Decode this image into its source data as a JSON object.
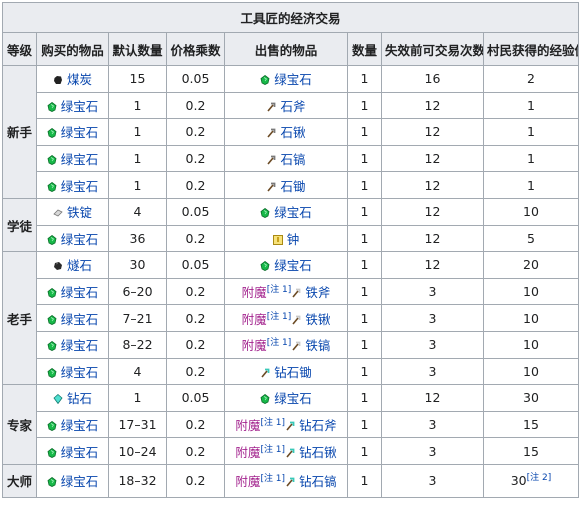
{
  "table": {
    "title": "工具匠的经济交易",
    "headers": [
      "等级",
      "购买的物品",
      "默认数量",
      "价格乘数",
      "出售的物品",
      "数量",
      "失效前可交易次数",
      "村民获得的经验值"
    ],
    "levels": [
      {
        "label": "新手",
        "rows": [
          {
            "buy": {
              "icon": "coal-icon",
              "name": "煤炭"
            },
            "qty": "15",
            "mult": "0.05",
            "sell": {
              "icon": "emerald-icon",
              "prefix": "",
              "name": "绿宝石"
            },
            "sqty": "1",
            "uses": "16",
            "xp": "2"
          },
          {
            "buy": {
              "icon": "emerald-icon",
              "name": "绿宝石"
            },
            "qty": "1",
            "mult": "0.2",
            "sell": {
              "icon": "stone-axe-icon",
              "prefix": "",
              "name": "石斧"
            },
            "sqty": "1",
            "uses": "12",
            "xp": "1"
          },
          {
            "buy": {
              "icon": "emerald-icon",
              "name": "绿宝石"
            },
            "qty": "1",
            "mult": "0.2",
            "sell": {
              "icon": "stone-shovel-icon",
              "prefix": "",
              "name": "石锹"
            },
            "sqty": "1",
            "uses": "12",
            "xp": "1"
          },
          {
            "buy": {
              "icon": "emerald-icon",
              "name": "绿宝石"
            },
            "qty": "1",
            "mult": "0.2",
            "sell": {
              "icon": "stone-pickaxe-icon",
              "prefix": "",
              "name": "石镐"
            },
            "sqty": "1",
            "uses": "12",
            "xp": "1"
          },
          {
            "buy": {
              "icon": "emerald-icon",
              "name": "绿宝石"
            },
            "qty": "1",
            "mult": "0.2",
            "sell": {
              "icon": "stone-hoe-icon",
              "prefix": "",
              "name": "石锄"
            },
            "sqty": "1",
            "uses": "12",
            "xp": "1"
          }
        ]
      },
      {
        "label": "学徒",
        "rows": [
          {
            "buy": {
              "icon": "iron-ingot-icon",
              "name": "铁锭"
            },
            "qty": "4",
            "mult": "0.05",
            "sell": {
              "icon": "emerald-icon",
              "prefix": "",
              "name": "绿宝石"
            },
            "sqty": "1",
            "uses": "12",
            "xp": "10"
          },
          {
            "buy": {
              "icon": "emerald-icon",
              "name": "绿宝石"
            },
            "qty": "36",
            "mult": "0.2",
            "sell": {
              "icon": "bell-icon",
              "prefix": "",
              "name": "钟"
            },
            "sqty": "1",
            "uses": "12",
            "xp": "5"
          }
        ]
      },
      {
        "label": "老手",
        "rows": [
          {
            "buy": {
              "icon": "flint-icon",
              "name": "燧石"
            },
            "qty": "30",
            "mult": "0.05",
            "sell": {
              "icon": "emerald-icon",
              "prefix": "",
              "name": "绿宝石"
            },
            "sqty": "1",
            "uses": "12",
            "xp": "20"
          },
          {
            "buy": {
              "icon": "emerald-icon",
              "name": "绿宝石"
            },
            "qty": "6–20",
            "mult": "0.2",
            "sell": {
              "icon": "iron-axe-icon",
              "prefix": "附魔",
              "note": "[注 1]",
              "name": "铁斧"
            },
            "sqty": "1",
            "uses": "3",
            "xp": "10"
          },
          {
            "buy": {
              "icon": "emerald-icon",
              "name": "绿宝石"
            },
            "qty": "7–21",
            "mult": "0.2",
            "sell": {
              "icon": "iron-shovel-icon",
              "prefix": "附魔",
              "note": "[注 1]",
              "name": "铁锹"
            },
            "sqty": "1",
            "uses": "3",
            "xp": "10"
          },
          {
            "buy": {
              "icon": "emerald-icon",
              "name": "绿宝石"
            },
            "qty": "8–22",
            "mult": "0.2",
            "sell": {
              "icon": "iron-pickaxe-icon",
              "prefix": "附魔",
              "note": "[注 1]",
              "name": "铁镐"
            },
            "sqty": "1",
            "uses": "3",
            "xp": "10"
          },
          {
            "buy": {
              "icon": "emerald-icon",
              "name": "绿宝石"
            },
            "qty": "4",
            "mult": "0.2",
            "sell": {
              "icon": "diamond-hoe-icon",
              "prefix": "",
              "name": "钻石锄"
            },
            "sqty": "1",
            "uses": "3",
            "xp": "10"
          }
        ]
      },
      {
        "label": "专家",
        "rows": [
          {
            "buy": {
              "icon": "diamond-icon",
              "name": "钻石"
            },
            "qty": "1",
            "mult": "0.05",
            "sell": {
              "icon": "emerald-icon",
              "prefix": "",
              "name": "绿宝石"
            },
            "sqty": "1",
            "uses": "12",
            "xp": "30"
          },
          {
            "buy": {
              "icon": "emerald-icon",
              "name": "绿宝石"
            },
            "qty": "17–31",
            "mult": "0.2",
            "sell": {
              "icon": "diamond-axe-icon",
              "prefix": "附魔",
              "note": "[注 1]",
              "name": "钻石斧"
            },
            "sqty": "1",
            "uses": "3",
            "xp": "15"
          },
          {
            "buy": {
              "icon": "emerald-icon",
              "name": "绿宝石"
            },
            "qty": "10–24",
            "mult": "0.2",
            "sell": {
              "icon": "diamond-shovel-icon",
              "prefix": "附魔",
              "note": "[注 1]",
              "name": "钻石锹"
            },
            "sqty": "1",
            "uses": "3",
            "xp": "15"
          }
        ]
      },
      {
        "label": "大师",
        "rows": [
          {
            "buy": {
              "icon": "emerald-icon",
              "name": "绿宝石"
            },
            "qty": "18–32",
            "mult": "0.2",
            "sell": {
              "icon": "diamond-pickaxe-icon",
              "prefix": "附魔",
              "note": "[注 1]",
              "name": "钻石镐"
            },
            "sqty": "1",
            "uses": "3",
            "xp": "30",
            "xp_note": "[注 2]"
          }
        ]
      }
    ]
  },
  "colors": {
    "link": "#0645ad",
    "enchant": "#a3248e",
    "header_bg": "#eaecf0",
    "border": "#a2a9b1"
  }
}
